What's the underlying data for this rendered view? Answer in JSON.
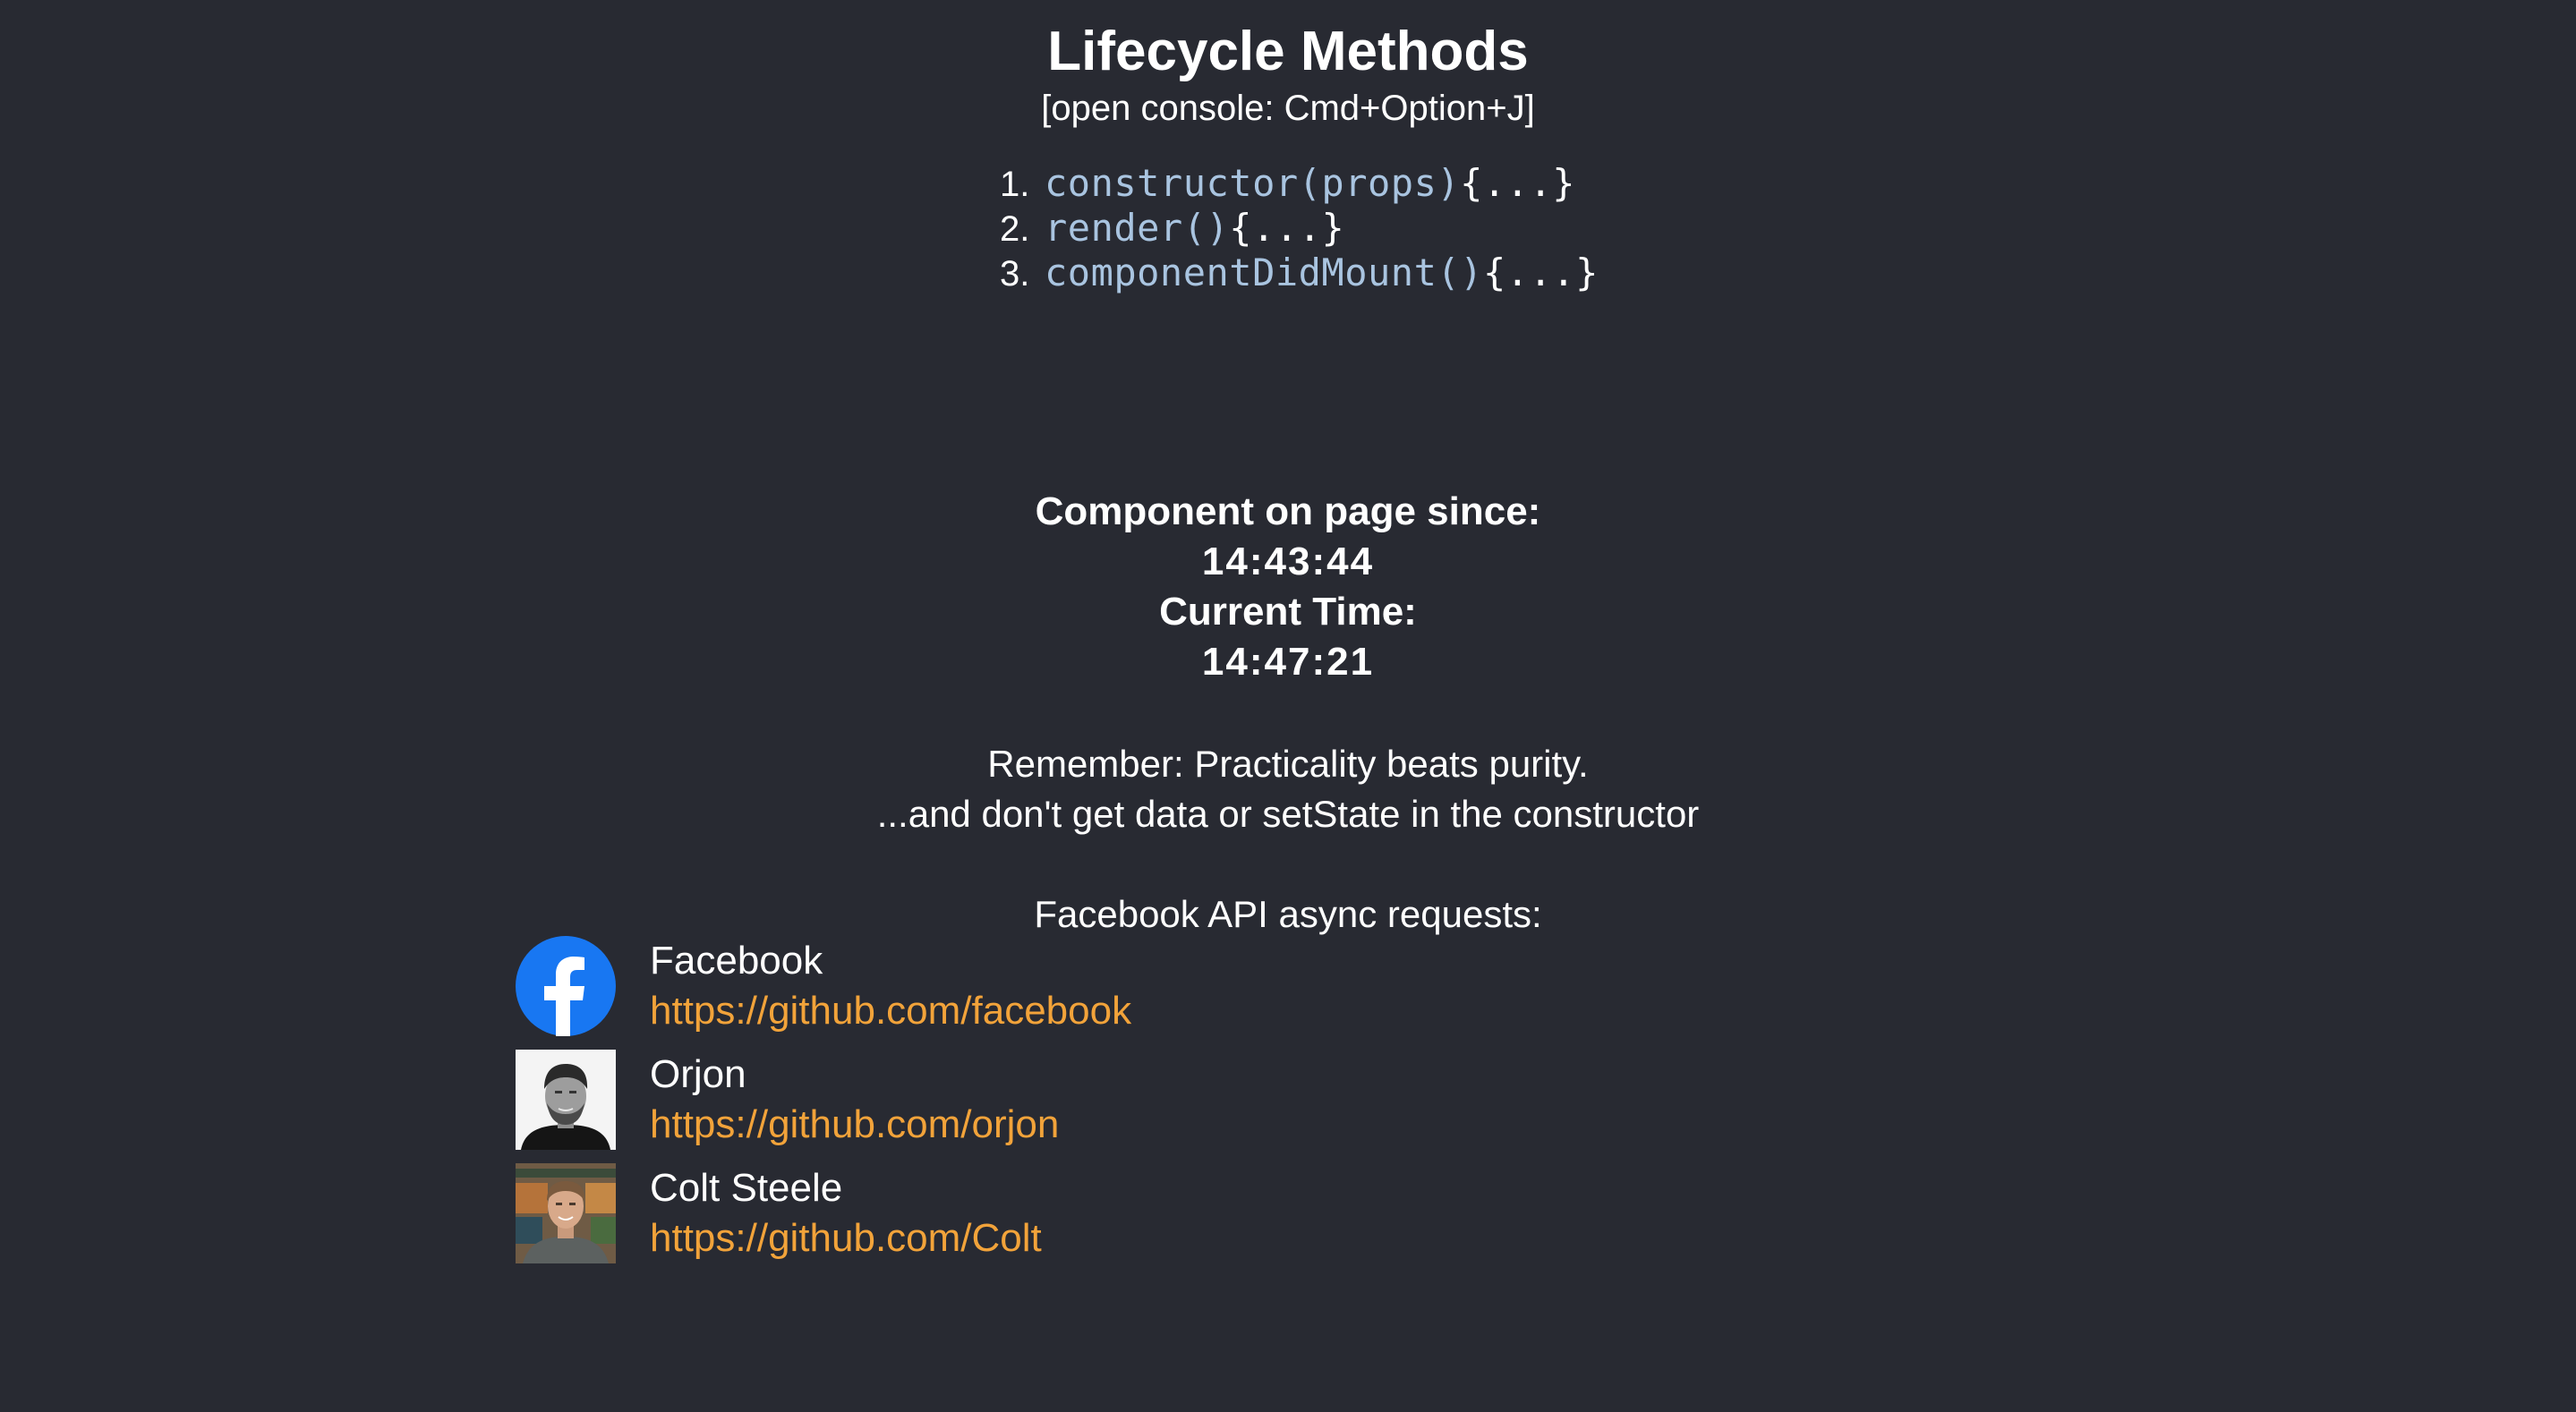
{
  "title": "Lifecycle Methods",
  "subtitle": "[open console: Cmd+Option+J]",
  "methods": [
    {
      "num": "1.",
      "name": "constructor(props)",
      "body": "{...}"
    },
    {
      "num": "2.",
      "name": "render()",
      "body": "{...}"
    },
    {
      "num": "3.",
      "name": "componentDidMount()",
      "body": "{...}"
    }
  ],
  "timer": {
    "since_label": "Component on page since:",
    "since_value": "14:43:44",
    "current_label": "Current Time:",
    "current_value": "14:47:21"
  },
  "remember": {
    "line1": "Remember: Practicality beats purity.",
    "line2": "...and don't get data or setState in the constructor"
  },
  "api_heading": "Facebook API async requests:",
  "users": [
    {
      "name": "Facebook",
      "url": "https://github.com/facebook",
      "avatar": "facebook-logo-icon"
    },
    {
      "name": "Orjon",
      "url": "https://github.com/orjon",
      "avatar": "orjon-photo"
    },
    {
      "name": "Colt Steele",
      "url": "https://github.com/Colt",
      "avatar": "colt-steele-photo"
    }
  ],
  "colors": {
    "background": "#282a32",
    "text": "#ffffff",
    "code": "#a9c4e0",
    "link": "#f2a33a",
    "facebook_blue": "#1877f2"
  }
}
